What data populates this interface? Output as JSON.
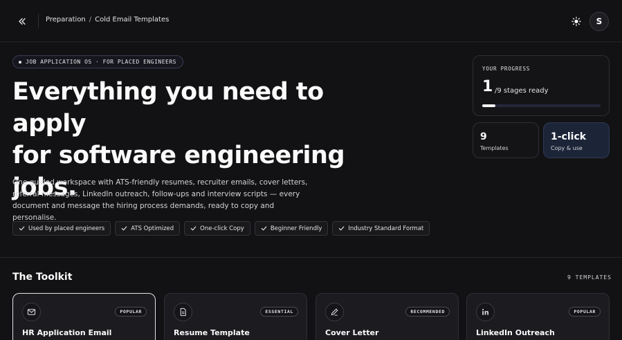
{
  "header": {
    "breadcrumb": [
      "Preparation",
      "Cold Email Templates"
    ],
    "breadcrumb_sep": "/",
    "avatar_initial": "S"
  },
  "hero": {
    "eyebrow": "JOB APPLICATION OS · FOR PLACED ENGINEERS",
    "title_lines": [
      "Everything you need to apply",
      "for software engineering",
      "jobs."
    ],
    "description": "One guided workspace with ATS-friendly resumes, recruiter emails, cover letters, referral messages, LinkedIn outreach, follow-ups and interview scripts — every document and message the hiring process demands, ready to copy and personalise.",
    "chips": [
      "Used by placed engineers",
      "ATS Optimized",
      "One-click Copy",
      "Beginner Friendly",
      "Industry Standard Format"
    ]
  },
  "progress": {
    "label": "YOUR PROGRESS",
    "value": "1",
    "suffix": "/9 stages ready",
    "fraction": 0.11
  },
  "stats": [
    {
      "value": "9",
      "label": "Templates"
    },
    {
      "value": "1-click",
      "label": "Copy & use"
    }
  ],
  "toolkit": {
    "title": "The Toolkit",
    "count": "9 TEMPLATES",
    "cards": [
      {
        "name": "HR Application Email",
        "badge": "POPULAR",
        "icon": "mail-icon"
      },
      {
        "name": "Resume Template",
        "badge": "ESSENTIAL",
        "icon": "document-icon"
      },
      {
        "name": "Cover Letter",
        "badge": "RECOMMENDED",
        "icon": "pen-icon"
      },
      {
        "name": "LinkedIn Outreach",
        "badge": "POPULAR",
        "icon": "linkedin-icon"
      }
    ]
  },
  "colors": {
    "background": "#121214",
    "accent_card": "#1c2538",
    "text": "#fafafa"
  }
}
